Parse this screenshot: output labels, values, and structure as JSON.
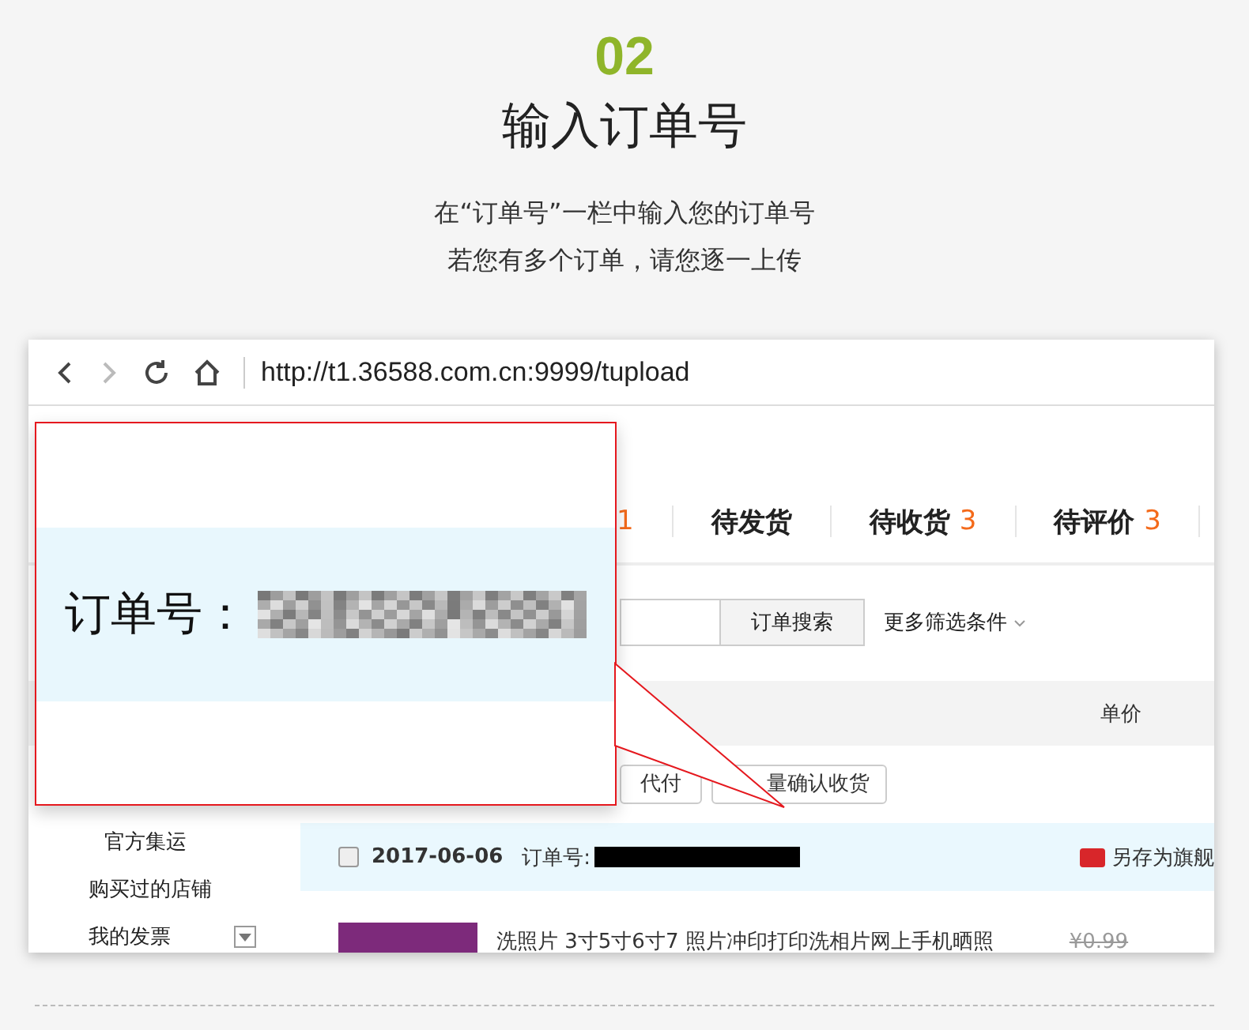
{
  "step": {
    "number": "02",
    "title": "输入订单号",
    "lines": [
      "在“订单号”一栏中输入您的订单号",
      "若您有多个订单，请您逐一上传"
    ]
  },
  "browser": {
    "url": "http://t1.36588.com.cn:9999/tupload"
  },
  "tabs": [
    {
      "count": "1"
    },
    {
      "label": "待发货"
    },
    {
      "label": "待收货",
      "count": "3"
    },
    {
      "label": "待评价",
      "count": "3"
    }
  ],
  "search": {
    "button": "订单搜索",
    "more": "更多筛选条件"
  },
  "table_header": {
    "price": "单价"
  },
  "actions": [
    "代付",
    "量确认收货"
  ],
  "sidebar": {
    "items": [
      {
        "label": "官方集运",
        "dropdown": false
      },
      {
        "label": "购买过的店铺",
        "dropdown": false
      },
      {
        "label": "我的发票",
        "dropdown": true
      }
    ]
  },
  "order": {
    "checked": false,
    "date": "2017-06-06",
    "number_label": "订单号:",
    "shop_action": "另存为旗舰"
  },
  "product": {
    "title": "洗照片 3寸5寸6寸7 照片冲印打印洗相片网上手机晒照",
    "price": "¥0.99"
  },
  "callout": {
    "label": "订单号："
  }
}
